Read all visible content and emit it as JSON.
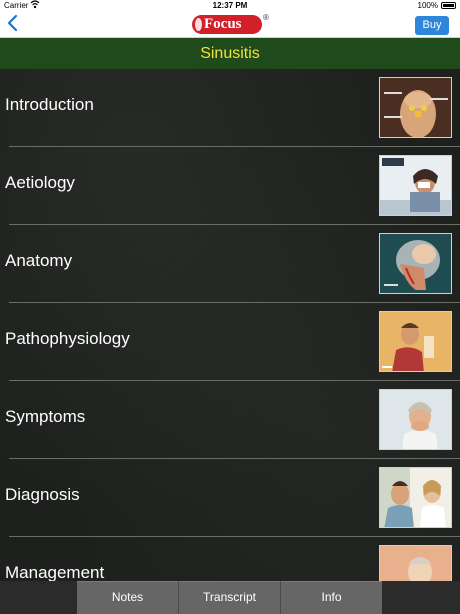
{
  "status_bar": {
    "carrier": "Carrier",
    "time": "12:37 PM",
    "battery": "100%"
  },
  "nav_bar": {
    "logo_text": "Focus",
    "logo_mark": "®",
    "buy_label": "Buy"
  },
  "page_title": "Sinusitis",
  "topics": [
    {
      "label": "Introduction"
    },
    {
      "label": "Aetiology"
    },
    {
      "label": "Anatomy"
    },
    {
      "label": "Pathophysiology"
    },
    {
      "label": "Symptoms"
    },
    {
      "label": "Diagnosis"
    },
    {
      "label": "Management"
    }
  ],
  "tabs": [
    {
      "label": "Notes"
    },
    {
      "label": "Transcript"
    },
    {
      "label": "Info"
    }
  ],
  "colors": {
    "title_bar_bg": "#1f4a1c",
    "title_text": "#f2e23a",
    "buy_button": "#2d86d9",
    "back_arrow": "#1a74d8",
    "logo_red": "#d2202a"
  }
}
